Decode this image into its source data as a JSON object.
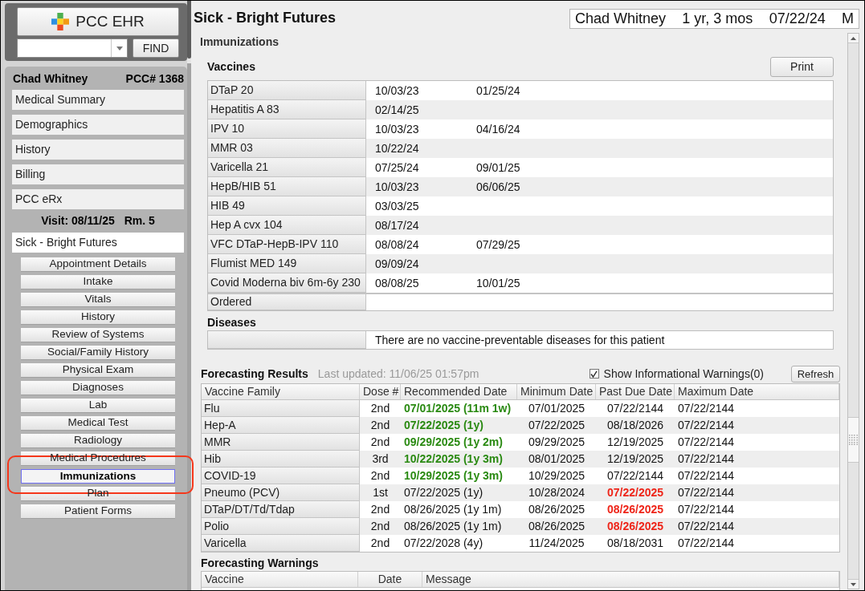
{
  "app": {
    "logo_label": "PCC EHR",
    "find_button": "FIND"
  },
  "patient_panel": {
    "name": "Chad Whitney",
    "pcc_number": "PCC# 1368",
    "items": [
      {
        "label": "Medical Summary"
      },
      {
        "label": "Demographics"
      },
      {
        "label": "History"
      },
      {
        "label": "Billing"
      },
      {
        "label": "PCC eRx"
      }
    ],
    "visit_date": "Visit: 08/11/25",
    "room": "Rm. 5",
    "visit_title": "Sick - Bright Futures",
    "visit_items": [
      {
        "label": "Appointment Details",
        "selected": false,
        "highlighted": false
      },
      {
        "label": "Intake",
        "selected": false,
        "highlighted": false
      },
      {
        "label": "Vitals",
        "selected": false,
        "highlighted": false
      },
      {
        "label": "History",
        "selected": false,
        "highlighted": false
      },
      {
        "label": "Review of Systems",
        "selected": false,
        "highlighted": false
      },
      {
        "label": "Social/Family History",
        "selected": false,
        "highlighted": false
      },
      {
        "label": "Physical Exam",
        "selected": false,
        "highlighted": false
      },
      {
        "label": "Diagnoses",
        "selected": false,
        "highlighted": false
      },
      {
        "label": "Lab",
        "selected": false,
        "highlighted": false
      },
      {
        "label": "Medical Test",
        "selected": false,
        "highlighted": false
      },
      {
        "label": "Radiology",
        "selected": false,
        "highlighted": false
      },
      {
        "label": "Medical Procedures",
        "selected": false,
        "highlighted": false
      },
      {
        "label": "Immunizations",
        "selected": true,
        "highlighted": true
      },
      {
        "label": "Plan",
        "selected": false,
        "highlighted": false
      },
      {
        "label": "Patient Forms",
        "selected": false,
        "highlighted": false
      }
    ]
  },
  "header": {
    "title": "Sick - Bright Futures",
    "patient_name": "Chad Whitney",
    "age": "1 yr, 3 mos",
    "birth_date": "07/22/24",
    "sex": "M"
  },
  "immunizations": {
    "title": "Immunizations",
    "vaccines": {
      "title": "Vaccines",
      "print_button": "Print",
      "rows": [
        {
          "name": "DTaP 20",
          "dates": [
            "10/03/23",
            "01/25/24"
          ]
        },
        {
          "name": "Hepatitis A 83",
          "dates": [
            "02/14/25"
          ]
        },
        {
          "name": "IPV 10",
          "dates": [
            "10/03/23",
            "04/16/24"
          ]
        },
        {
          "name": "MMR 03",
          "dates": [
            "10/22/24"
          ]
        },
        {
          "name": "Varicella 21",
          "dates": [
            "07/25/24",
            "09/01/25"
          ]
        },
        {
          "name": "HepB/HIB 51",
          "dates": [
            "10/03/23",
            "06/06/25"
          ]
        },
        {
          "name": "HIB 49",
          "dates": [
            "03/03/25"
          ]
        },
        {
          "name": "Hep A cvx 104",
          "dates": [
            "08/17/24"
          ]
        },
        {
          "name": "VFC DTaP-HepB-IPV 110",
          "dates": [
            "08/08/24",
            "07/29/25"
          ]
        },
        {
          "name": "Flumist MED 149",
          "dates": [
            "09/09/24"
          ]
        },
        {
          "name": "Covid Moderna biv 6m-6y 230",
          "dates": [
            "08/08/25",
            "10/01/25"
          ]
        }
      ],
      "ordered_label": "Ordered"
    },
    "diseases": {
      "title": "Diseases",
      "message": "There are no vaccine-preventable diseases for this patient"
    }
  },
  "forecasting": {
    "title": "Forecasting Results",
    "last_updated": "Last updated: 11/06/25 01:57pm",
    "show_warnings": {
      "label": "Show Informational Warnings(0)",
      "checked": true
    },
    "refresh_button": "Refresh",
    "columns": [
      "Vaccine Family",
      "Dose #",
      "Recommended Date",
      "Minimum Date",
      "Past Due Date",
      "Maximum Date"
    ],
    "rows": [
      {
        "vaccine_family": "Flu",
        "dose": "2nd",
        "recommended_date": "07/01/2025 (11m 1w)",
        "recommended_due": true,
        "minimum_date": "07/01/2025",
        "past_due_date": "07/22/2144",
        "past_due": false,
        "maximum_date": "07/22/2144"
      },
      {
        "vaccine_family": "Hep-A",
        "dose": "2nd",
        "recommended_date": "07/22/2025 (1y)",
        "recommended_due": true,
        "minimum_date": "07/22/2025",
        "past_due_date": "08/18/2026",
        "past_due": false,
        "maximum_date": "07/22/2144"
      },
      {
        "vaccine_family": "MMR",
        "dose": "2nd",
        "recommended_date": "09/29/2025 (1y 2m)",
        "recommended_due": true,
        "minimum_date": "09/29/2025",
        "past_due_date": "12/19/2025",
        "past_due": false,
        "maximum_date": "07/22/2144"
      },
      {
        "vaccine_family": "Hib",
        "dose": "3rd",
        "recommended_date": "10/22/2025 (1y 3m)",
        "recommended_due": true,
        "minimum_date": "08/01/2025",
        "past_due_date": "12/19/2025",
        "past_due": false,
        "maximum_date": "07/22/2144"
      },
      {
        "vaccine_family": "COVID-19",
        "dose": "2nd",
        "recommended_date": "10/29/2025 (1y 3m)",
        "recommended_due": true,
        "minimum_date": "10/29/2025",
        "past_due_date": "07/22/2144",
        "past_due": false,
        "maximum_date": "07/22/2144"
      },
      {
        "vaccine_family": "Pneumo (PCV)",
        "dose": "1st",
        "recommended_date": "07/22/2025 (1y)",
        "recommended_due": false,
        "minimum_date": "10/28/2024",
        "past_due_date": "07/22/2025",
        "past_due": true,
        "maximum_date": "07/22/2144"
      },
      {
        "vaccine_family": "DTaP/DT/Td/Tdap",
        "dose": "2nd",
        "recommended_date": "08/26/2025 (1y 1m)",
        "recommended_due": false,
        "minimum_date": "08/26/2025",
        "past_due_date": "08/26/2025",
        "past_due": true,
        "maximum_date": "07/22/2144"
      },
      {
        "vaccine_family": "Polio",
        "dose": "2nd",
        "recommended_date": "08/26/2025 (1y 1m)",
        "recommended_due": false,
        "minimum_date": "08/26/2025",
        "past_due_date": "08/26/2025",
        "past_due": true,
        "maximum_date": "07/22/2144"
      },
      {
        "vaccine_family": "Varicella",
        "dose": "2nd",
        "recommended_date": "07/22/2028 (4y)",
        "recommended_due": false,
        "minimum_date": "11/24/2025",
        "past_due_date": "08/18/2031",
        "past_due": false,
        "maximum_date": "07/22/2144"
      }
    ]
  },
  "warnings": {
    "title": "Forecasting Warnings",
    "columns": [
      "Vaccine",
      "Date",
      "Message"
    ]
  }
}
